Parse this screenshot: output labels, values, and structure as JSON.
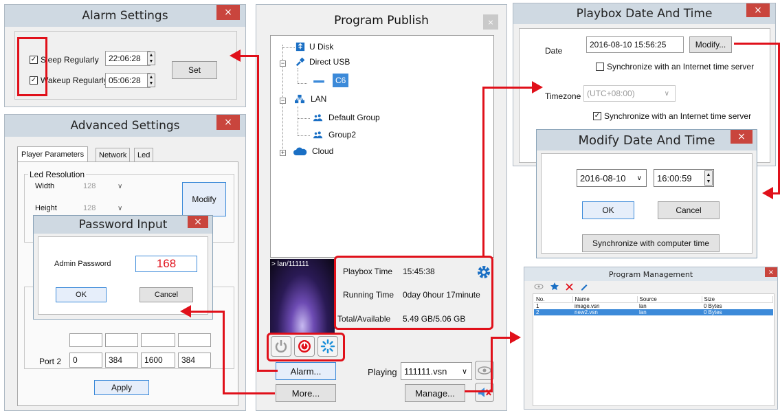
{
  "alarm_settings": {
    "title": "Alarm Settings",
    "close": "×",
    "sleep_label": "Sleep Regularly",
    "sleep_checked": true,
    "sleep_time": "22:06:28",
    "wakeup_label": "Wakeup Regularly",
    "wakeup_checked": true,
    "wakeup_time": "05:06:28",
    "set_label": "Set"
  },
  "advanced_settings": {
    "title": "Advanced Settings",
    "close": "×",
    "tabs": [
      "Player Parameters",
      "Network",
      "Led"
    ],
    "led_resolution_label": "Led Resolution",
    "width_label": "Width",
    "width_value": "128",
    "height_label": "Height",
    "height_value": "128",
    "modify_label": "Modify",
    "port2_label": "Port 2",
    "port2_values": [
      "0",
      "384",
      "1600",
      "384"
    ],
    "apply_label": "Apply"
  },
  "password_input": {
    "title": "Password Input",
    "close": "×",
    "label": "Admin Password",
    "value": "168",
    "ok": "OK",
    "cancel": "Cancel"
  },
  "program_publish": {
    "title": "Program Publish",
    "close": "×",
    "tree": {
      "udisk": "U Disk",
      "direct_usb": "Direct USB",
      "c6": "C6",
      "lan": "LAN",
      "default_group": "Default Group",
      "group2": "Group2",
      "cloud": "Cloud"
    },
    "preview_label": "> lan/111111",
    "playbox_time_label": "Playbox Time",
    "playbox_time_value": "15:45:38",
    "running_time_label": "Running Time",
    "running_time_value": "0day 0hour 17minute",
    "storage_label": "Total/Available",
    "storage_value": "5.49 GB/5.06 GB",
    "alarm_button": "Alarm...",
    "more_button": "More...",
    "playing_label": "Playing",
    "playing_value": "111111.vsn",
    "manage_button": "Manage..."
  },
  "playbox_datetime": {
    "title": "Playbox Date And Time",
    "close": "×",
    "date_label": "Date",
    "date_value": "2016-08-10 15:56:25",
    "modify_label": "Modify...",
    "sync_label_1": "Synchronize with an Internet time server",
    "sync_checked_1": false,
    "timezone_label": "Timezone",
    "timezone_value": "(UTC+08:00)",
    "sync_label_2": "Synchronize with an Internet time server",
    "sync_checked_2": true
  },
  "modify_datetime": {
    "title": "Modify Date And Time",
    "close": "×",
    "date_value": "2016-08-10",
    "time_value": "16:00:59",
    "ok": "OK",
    "cancel": "Cancel",
    "sync_button": "Synchronize with computer time"
  },
  "program_management": {
    "title": "Program Management",
    "close": "×",
    "columns": [
      "No.",
      "Name",
      "Source",
      "Size"
    ],
    "rows": [
      [
        "1",
        "image.vsn",
        "lan",
        "0 Bytes"
      ],
      [
        "2",
        "new2.vsn",
        "lan",
        "0 Bytes"
      ]
    ]
  },
  "icons": [
    "usb-icon",
    "usb-plug-icon",
    "device-icon",
    "network-icon",
    "group-icon",
    "cloud-icon",
    "gear-icon",
    "power-icon",
    "stop-icon",
    "refresh-icon",
    "eye-icon",
    "speaker-icon",
    "star-icon",
    "delete-icon",
    "edit-icon"
  ],
  "colors": {
    "accent_red": "#e0101a",
    "titlebar": "#cfd9e2",
    "close_red": "#c9453d",
    "selection_blue": "#3c8ad9",
    "password_red": "#e0101a"
  }
}
